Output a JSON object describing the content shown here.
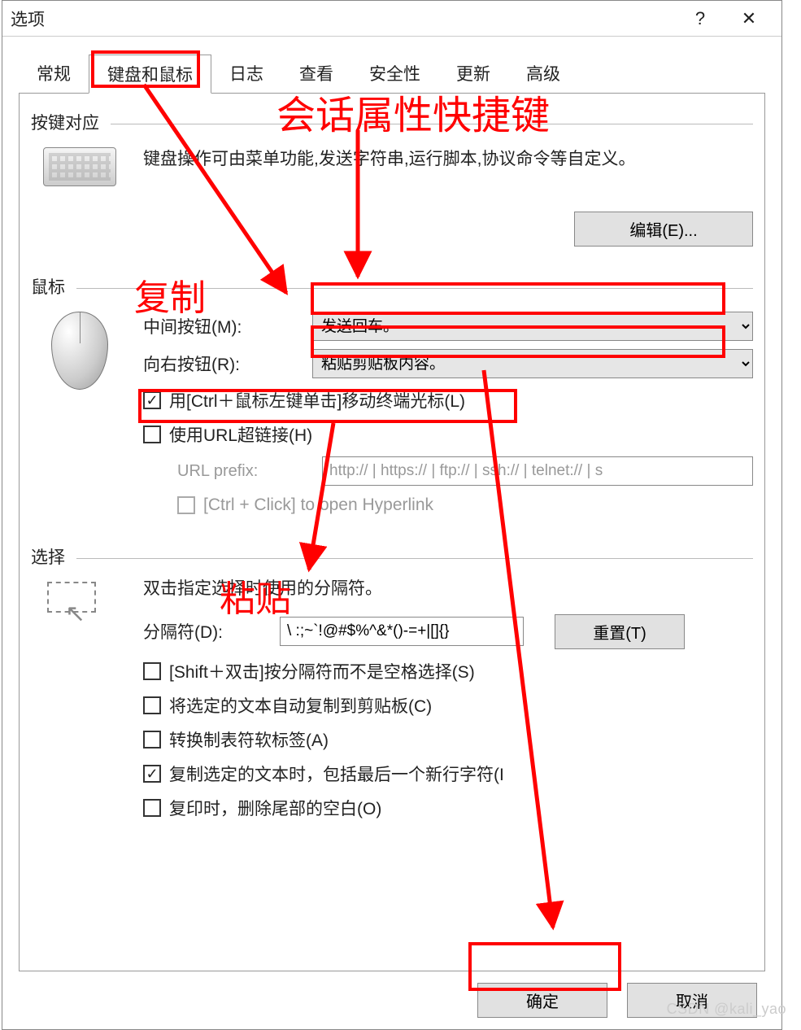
{
  "window": {
    "title": "选项",
    "help_label": "?",
    "close_label": "✕"
  },
  "tabs": {
    "items": [
      {
        "label": "常规"
      },
      {
        "label": "键盘和鼠标"
      },
      {
        "label": "日志"
      },
      {
        "label": "查看"
      },
      {
        "label": "安全性"
      },
      {
        "label": "更新"
      },
      {
        "label": "高级"
      }
    ],
    "active_index": 1
  },
  "key_section": {
    "header": "按键对应",
    "desc": "键盘操作可由菜单功能,发送字符串,运行脚本,协议命令等自定义。",
    "edit_button": "编辑(E)..."
  },
  "mouse_section": {
    "header": "鼠标",
    "middle_label": "中间按钮(M):",
    "middle_value": "发送回车。",
    "right_label": "向右按钮(R):",
    "right_value": "粘贴剪贴板内容。",
    "ctrl_click_move": {
      "checked": true,
      "label": "用[Ctrl＋鼠标左键单击]移动终端光标(L)"
    },
    "url_hyperlink": {
      "checked": false,
      "label": "使用URL超链接(H)"
    },
    "url_prefix_label": "URL prefix:",
    "url_prefix_value": "http:// | https:// | ftp:// | ssh:// | telnet:// | s",
    "ctrl_click_open": {
      "checked": false,
      "label": "[Ctrl + Click] to open Hyperlink"
    }
  },
  "select_section": {
    "header": "选择",
    "desc": "双击指定选择时使用的分隔符。",
    "delim_label": "分隔符(D):",
    "delim_value": "\\ :;~`!@#$%^&*()-=+|[]{}",
    "reset_button": "重置(T)",
    "shift_dbl": {
      "checked": false,
      "label": "[Shift＋双击]按分隔符而不是空格选择(S)"
    },
    "auto_copy": {
      "checked": false,
      "label": "将选定的文本自动复制到剪贴板(C)"
    },
    "tab_soft": {
      "checked": false,
      "label": "转换制表符软标签(A)"
    },
    "copy_newline": {
      "checked": true,
      "label": "复制选定的文本时，包括最后一个新行字符(I"
    },
    "trim_trailing": {
      "checked": false,
      "label": "复印时，删除尾部的空白(O)"
    }
  },
  "footer": {
    "ok": "确定",
    "cancel": "取消"
  },
  "annotations": {
    "title": "会话属性快捷键",
    "copy": "复制",
    "paste": "粘贴"
  },
  "watermark": "CSDN @kali_yao"
}
